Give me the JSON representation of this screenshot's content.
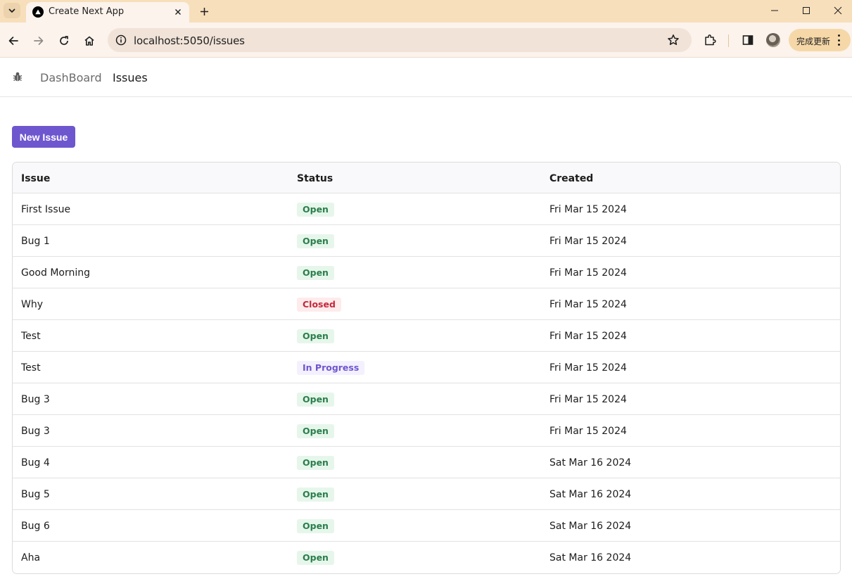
{
  "browser": {
    "tab_title": "Create Next App",
    "url": "localhost:5050/issues",
    "update_label": "完成更新"
  },
  "nav": {
    "links": [
      {
        "label": "DashBoard",
        "active": false
      },
      {
        "label": "Issues",
        "active": true
      }
    ]
  },
  "toolbar": {
    "new_issue_label": "New Issue"
  },
  "status_colors": {
    "Open": {
      "text": "#2a7e4b",
      "bg": "#e6f6eb"
    },
    "Closed": {
      "text": "#c4283b",
      "bg": "#feebec"
    },
    "In Progress": {
      "text": "#6e56cf",
      "bg": "#f4f0fe"
    }
  },
  "table": {
    "columns": [
      "Issue",
      "Status",
      "Created"
    ],
    "rows": [
      {
        "title": "First Issue",
        "status": "Open",
        "created": "Fri Mar 15 2024"
      },
      {
        "title": "Bug 1",
        "status": "Open",
        "created": "Fri Mar 15 2024"
      },
      {
        "title": "Good Morning",
        "status": "Open",
        "created": "Fri Mar 15 2024"
      },
      {
        "title": "Why",
        "status": "Closed",
        "created": "Fri Mar 15 2024"
      },
      {
        "title": "Test",
        "status": "Open",
        "created": "Fri Mar 15 2024"
      },
      {
        "title": "Test",
        "status": "In Progress",
        "created": "Fri Mar 15 2024"
      },
      {
        "title": "Bug 3",
        "status": "Open",
        "created": "Fri Mar 15 2024"
      },
      {
        "title": "Bug 3",
        "status": "Open",
        "created": "Fri Mar 15 2024"
      },
      {
        "title": "Bug 4",
        "status": "Open",
        "created": "Sat Mar 16 2024"
      },
      {
        "title": "Bug 5",
        "status": "Open",
        "created": "Sat Mar 16 2024"
      },
      {
        "title": "Bug 6",
        "status": "Open",
        "created": "Sat Mar 16 2024"
      },
      {
        "title": "Aha",
        "status": "Open",
        "created": "Sat Mar 16 2024"
      }
    ]
  }
}
